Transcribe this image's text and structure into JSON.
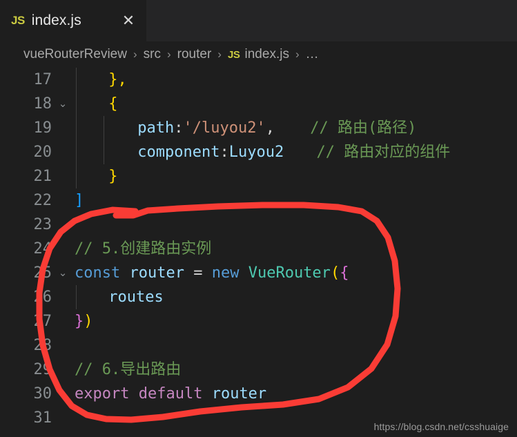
{
  "window": {
    "background": "#1e1e1e",
    "tabbar_background": "#252526"
  },
  "tab": {
    "file_icon_label": "JS",
    "title": "index.js",
    "close_label": "✕"
  },
  "breadcrumb": {
    "separator": "›",
    "js_label": "JS",
    "items": [
      {
        "label": "vueRouterReview"
      },
      {
        "label": "src"
      },
      {
        "label": "router"
      },
      {
        "label": "index.js"
      },
      {
        "label": "…"
      }
    ]
  },
  "editor": {
    "fold_chevron": "⌄",
    "lines": [
      {
        "number": "17",
        "fold": "",
        "text": "  },"
      },
      {
        "number": "18",
        "fold": "⌄",
        "text": "  {"
      },
      {
        "number": "19",
        "fold": "",
        "text": "    path:'/luyou2',    // 路由(路径)"
      },
      {
        "number": "20",
        "fold": "",
        "text": "    component:Luyou2   // 路由对应的组件"
      },
      {
        "number": "21",
        "fold": "",
        "text": "  }"
      },
      {
        "number": "22",
        "fold": "",
        "text": "]"
      },
      {
        "number": "23",
        "fold": "",
        "text": ""
      },
      {
        "number": "24",
        "fold": "",
        "text": "// 5.创建路由实例"
      },
      {
        "number": "25",
        "fold": "⌄",
        "text": "const router = new VueRouter({"
      },
      {
        "number": "26",
        "fold": "",
        "text": "  routes"
      },
      {
        "number": "27",
        "fold": "",
        "text": "})"
      },
      {
        "number": "28",
        "fold": "",
        "text": ""
      },
      {
        "number": "29",
        "fold": "",
        "text": "// 6.导出路由"
      },
      {
        "number": "30",
        "fold": "",
        "text": "export default router"
      },
      {
        "number": "31",
        "fold": "",
        "text": ""
      }
    ],
    "tokens": {
      "l17_brace": "},",
      "l18_brace": "{",
      "l19_key": "path",
      "l19_colon": ":",
      "l19_string": "'/luyou2'",
      "l19_comma": ",",
      "l19_comment": "// 路由(路径)",
      "l20_key": "component",
      "l20_colon": ":",
      "l20_value": "Luyou2",
      "l20_comment": "// 路由对应的组件",
      "l21_brace": "}",
      "l22_bracket": "]",
      "l24_comment": "// 5.创建路由实例",
      "l25_const": "const",
      "l25_name": "router",
      "l25_eq": "=",
      "l25_new": "new",
      "l25_class": "VueRouter",
      "l25_paren": "(",
      "l25_brace": "{",
      "l26_prop": "routes",
      "l27_brace": "}",
      "l27_paren": ")",
      "l29_comment": "// 6.导出路由",
      "l30_export": "export",
      "l30_default": "default",
      "l30_name": "router"
    }
  },
  "annotation": {
    "color": "#fa3c35",
    "shape": "hand-drawn-ellipse",
    "stroke_width": 9
  },
  "watermark": {
    "text": "https://blog.csdn.net/csshuaige"
  },
  "colors": {
    "editor_background": "#1e1e1e",
    "tabbar_background": "#252526",
    "line_number": "#888d90",
    "keyword": "#569cd6",
    "control_keyword": "#c586c0",
    "variable": "#9cdcfe",
    "type": "#4ec9b0",
    "string": "#ce9178",
    "comment": "#6a9955",
    "annotation_red": "#fa3c35"
  }
}
